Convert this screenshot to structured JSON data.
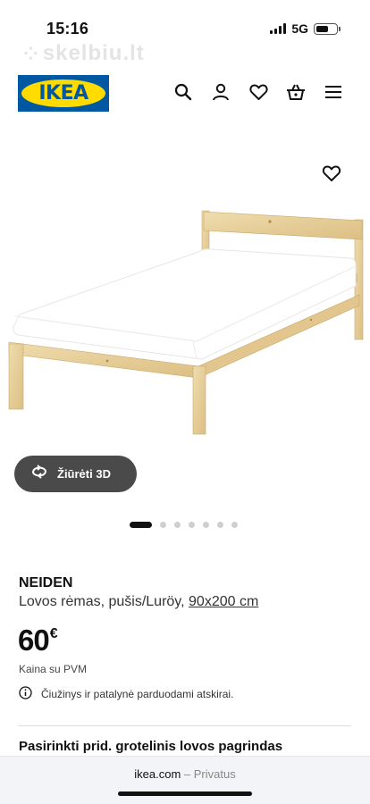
{
  "status_bar": {
    "time": "15:16",
    "network": "5G",
    "battery_level": 0.6
  },
  "watermark": {
    "text": "skelbiu.lt"
  },
  "header": {
    "logo_text": "IKEA",
    "icons": [
      "search-icon",
      "account-icon",
      "heart-icon",
      "basket-icon",
      "menu-icon"
    ]
  },
  "gallery": {
    "view_3d_label": "Žiūrėti 3D",
    "image_count": 7,
    "active_index": 0
  },
  "product": {
    "name": "NEIDEN",
    "description": "Lovos rėmas, pušis/Luröy,",
    "size": "90x200 cm",
    "price_amount": "60",
    "price_currency": "€",
    "vat_label": "Kaina su PVM",
    "note": "Čiužinys ir patalynė parduodami atskirai."
  },
  "section": {
    "title": "Pasirinkti prid. grotelinis lovos pagrindas"
  },
  "browser": {
    "domain": "ikea.com",
    "mode": "– Privatus"
  },
  "colors": {
    "ikea_blue": "#0058a3",
    "ikea_yellow": "#ffdb00",
    "pine_wood": "#e8d09a",
    "button_dark": "#4a4a4a"
  }
}
